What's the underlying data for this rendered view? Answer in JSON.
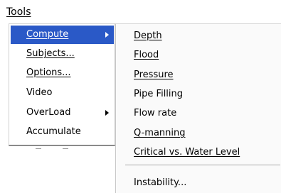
{
  "menubar": {
    "tools_label": "Tools"
  },
  "tools_menu": {
    "items": [
      {
        "label": "Compute",
        "has_submenu": true,
        "active": true
      },
      {
        "label": "Subjects...",
        "has_submenu": false
      },
      {
        "label": "Options...",
        "has_submenu": false
      },
      {
        "label": "Video",
        "has_submenu": false
      },
      {
        "label": "OverLoad",
        "has_submenu": true
      },
      {
        "label": "Accumulate",
        "has_submenu": false
      }
    ]
  },
  "compute_submenu": {
    "items": [
      {
        "label": "Depth"
      },
      {
        "label": "Flood"
      },
      {
        "label": "Pressure"
      },
      {
        "label": "Pipe Filling"
      },
      {
        "label": "Flow rate"
      },
      {
        "label": "Q-manning"
      },
      {
        "label": "Critical vs. Water Level"
      },
      {
        "label": "Instability..."
      }
    ]
  },
  "colors": {
    "highlight": "#2a59c7",
    "menu_background": "#ffffff"
  }
}
